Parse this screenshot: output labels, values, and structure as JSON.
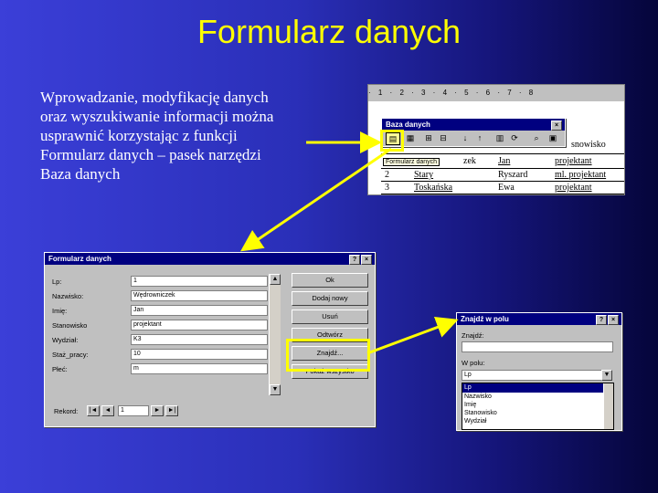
{
  "slide": {
    "title": "Formularz danych",
    "body_lines": [
      "Wprowadzanie, modyfikację danych",
      "oraz wyszukiwanie informacji można",
      "usprawnić korzystając z funkcji",
      "Formularz danych – pasek narzędzi",
      "Baza danych"
    ]
  },
  "colors": {
    "accent": "#ffff00",
    "titlebar": "#000080",
    "window": "#c0c0c0"
  },
  "document": {
    "ruler": "· 1 · 2 · 3 · 4 · 5 · 6 · 7 · 8",
    "toolbar_title": "Baza danych",
    "toolbar_close": "×",
    "tooltip": "Formularz danych",
    "header_tail": "snowisko",
    "row1": [
      "zek",
      "Jan",
      "projektant"
    ],
    "row2": [
      "2",
      "Stary",
      "Ryszard",
      "ml. projektant"
    ],
    "row3": [
      "3",
      "Toskańska",
      "Ewa",
      "projektant"
    ]
  },
  "form": {
    "title": "Formularz danych",
    "help": "?",
    "close": "×",
    "fields": [
      {
        "label": "Lp:",
        "value": "1"
      },
      {
        "label": "Nazwisko:",
        "value": "Wędrowniczek"
      },
      {
        "label": "Imię:",
        "value": "Jan"
      },
      {
        "label": "Stanowisko",
        "value": "projektant"
      },
      {
        "label": "Wydział:",
        "value": "K3"
      },
      {
        "label": "Staż_pracy:",
        "value": "10"
      },
      {
        "label": "Płeć:",
        "value": "m"
      }
    ],
    "buttons": [
      "Ok",
      "Dodaj nowy",
      "Usuń",
      "Odtwórz",
      "Znajdź...",
      "Pokaż wszystko"
    ],
    "record_label": "Rekord:",
    "record_value": "1",
    "nav": [
      "|◄",
      "◄",
      "►",
      "►|"
    ]
  },
  "find": {
    "title": "Znajdź w polu",
    "help": "?",
    "close": "×",
    "find_label": "Znajdź:",
    "find_value": "",
    "field_label": "W polu:",
    "field_value": "Lp",
    "options": [
      "Lp",
      "Nazwisko",
      "Imię",
      "Stanowisko",
      "Wydział"
    ]
  }
}
